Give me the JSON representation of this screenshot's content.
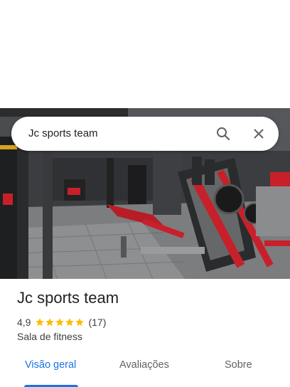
{
  "search": {
    "query": "Jc sports team"
  },
  "icons": {
    "search": "search-icon",
    "close": "close-icon",
    "star": "star-icon"
  },
  "place": {
    "name": "Jc sports team",
    "rating": "4,9",
    "stars": 5,
    "review_count": "(17)",
    "category": "Sala de fitness"
  },
  "tabs": [
    {
      "label": "Visão geral",
      "active": true
    },
    {
      "label": "Avaliações",
      "active": false
    },
    {
      "label": "Sobre",
      "active": false
    }
  ],
  "colors": {
    "accent": "#1a73e8",
    "star": "#fbbc04",
    "gym_red": "#c8202a"
  }
}
